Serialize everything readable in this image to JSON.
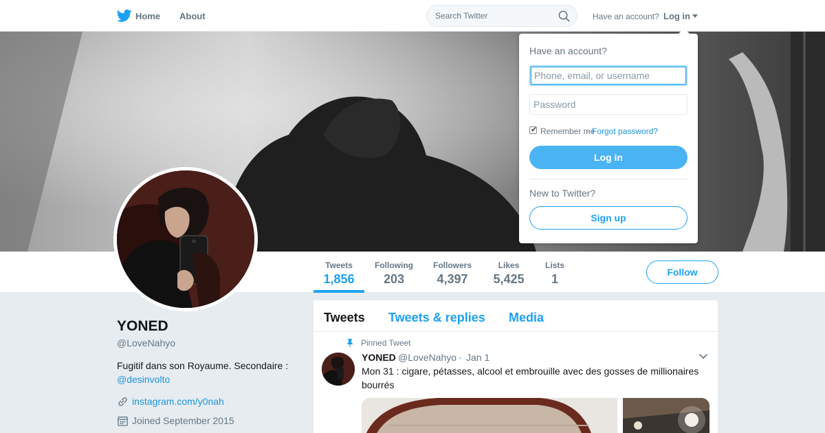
{
  "nav": {
    "logo_icon": "twitter-bird-icon",
    "home_label": "Home",
    "about_label": "About",
    "search_placeholder": "Search Twitter",
    "have_account_text": "Have an account?",
    "login_label": "Log in"
  },
  "profile": {
    "name": "YONED",
    "handle": "@LoveNahyo",
    "bio_text": "Fugitif dans son Royaume. Secondaire :",
    "bio_mention": "@desinvolto",
    "url": "instagram.com/y0nah",
    "joined": "Joined September 2015"
  },
  "stats": [
    {
      "label": "Tweets",
      "value": "1,856",
      "active": true
    },
    {
      "label": "Following",
      "value": "203"
    },
    {
      "label": "Followers",
      "value": "4,397"
    },
    {
      "label": "Likes",
      "value": "5,425"
    },
    {
      "label": "Lists",
      "value": "1"
    }
  ],
  "follow_label": "Follow",
  "timeline": {
    "tabs": [
      "Tweets",
      "Tweets & replies",
      "Media"
    ],
    "active_tab": "Tweets",
    "pinned_label": "Pinned Tweet",
    "tweet": {
      "name": "YONED",
      "handle": "@LoveNahyo",
      "separator": "·",
      "date": "Jan 1",
      "text": "Mon 31 : cigare, pétasses, alcool et embrouille avec des gosses de millionaires bourrés"
    }
  },
  "login_dropdown": {
    "title": "Have an account?",
    "username_placeholder": "Phone, email, or username",
    "password_placeholder": "Password",
    "remember_label": "Remember me",
    "separator": "·",
    "forgot_label": "Forgot password?",
    "remember_checked": true,
    "login_button": "Log in",
    "new_text": "New to Twitter?",
    "signup_button": "Sign up"
  },
  "colors": {
    "accent": "#1da1f2",
    "link": "#1b95e0",
    "background": "#e6ecf0",
    "login_button": "#4ab3f4"
  }
}
